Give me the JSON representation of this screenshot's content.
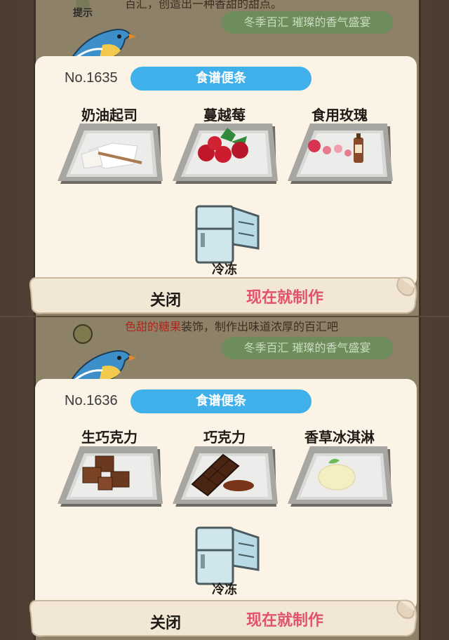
{
  "top": {
    "hint_label": "提示",
    "hint_text": "百汇，创造出一种香甜的甜点。",
    "banner": "冬季百汇 璀璨的香气盛宴",
    "recipe": {
      "number": "No.1635",
      "title": "食谱便条",
      "ingredients": [
        {
          "name": "奶油起司"
        },
        {
          "name": "蔓越莓"
        },
        {
          "name": "食用玫瑰"
        }
      ],
      "method": "冷冻",
      "close": "关闭",
      "make": "现在就制作"
    }
  },
  "bottom": {
    "hint_text_red": "色甜的糖果",
    "hint_text_rest": "装饰，制作出味道浓厚的百汇吧",
    "banner": "冬季百汇 璀璨的香气盛宴",
    "recipe": {
      "number": "No.1636",
      "title": "食谱便条",
      "ingredients": [
        {
          "name": "生巧克力"
        },
        {
          "name": "巧克力"
        },
        {
          "name": "香草冰淇淋"
        }
      ],
      "method": "冷冻",
      "close": "关闭",
      "make": "现在就制作"
    }
  },
  "colors": {
    "title_pill": "#3fb0ea",
    "make_button": "#e0536a",
    "card": "#fbf4e6",
    "banner": "#6f8c5c"
  }
}
